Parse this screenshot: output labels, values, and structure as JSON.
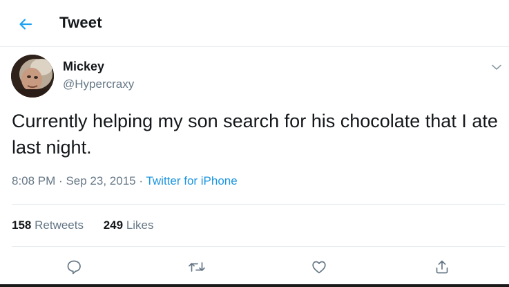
{
  "header": {
    "title": "Tweet",
    "back_icon": "arrow-left-icon"
  },
  "tweet": {
    "author": {
      "display_name": "Mickey",
      "handle": "@Hypercraxy",
      "avatar_icon": "user-avatar"
    },
    "text": "Currently helping my son search for his chocolate that I ate last night.",
    "time": "8:08 PM",
    "date": "Sep 23, 2015",
    "separator": "·",
    "source": "Twitter for iPhone",
    "stats": {
      "retweets_count": "158",
      "retweets_label": "Retweets",
      "likes_count": "249",
      "likes_label": "Likes"
    },
    "actions": [
      "reply-icon",
      "retweet-icon",
      "like-icon",
      "share-icon"
    ]
  },
  "colors": {
    "accent": "#1da1f2",
    "link": "#1b95e0",
    "secondary_text": "#657786",
    "primary_text": "#14171a",
    "divider": "#e6ecf0"
  }
}
